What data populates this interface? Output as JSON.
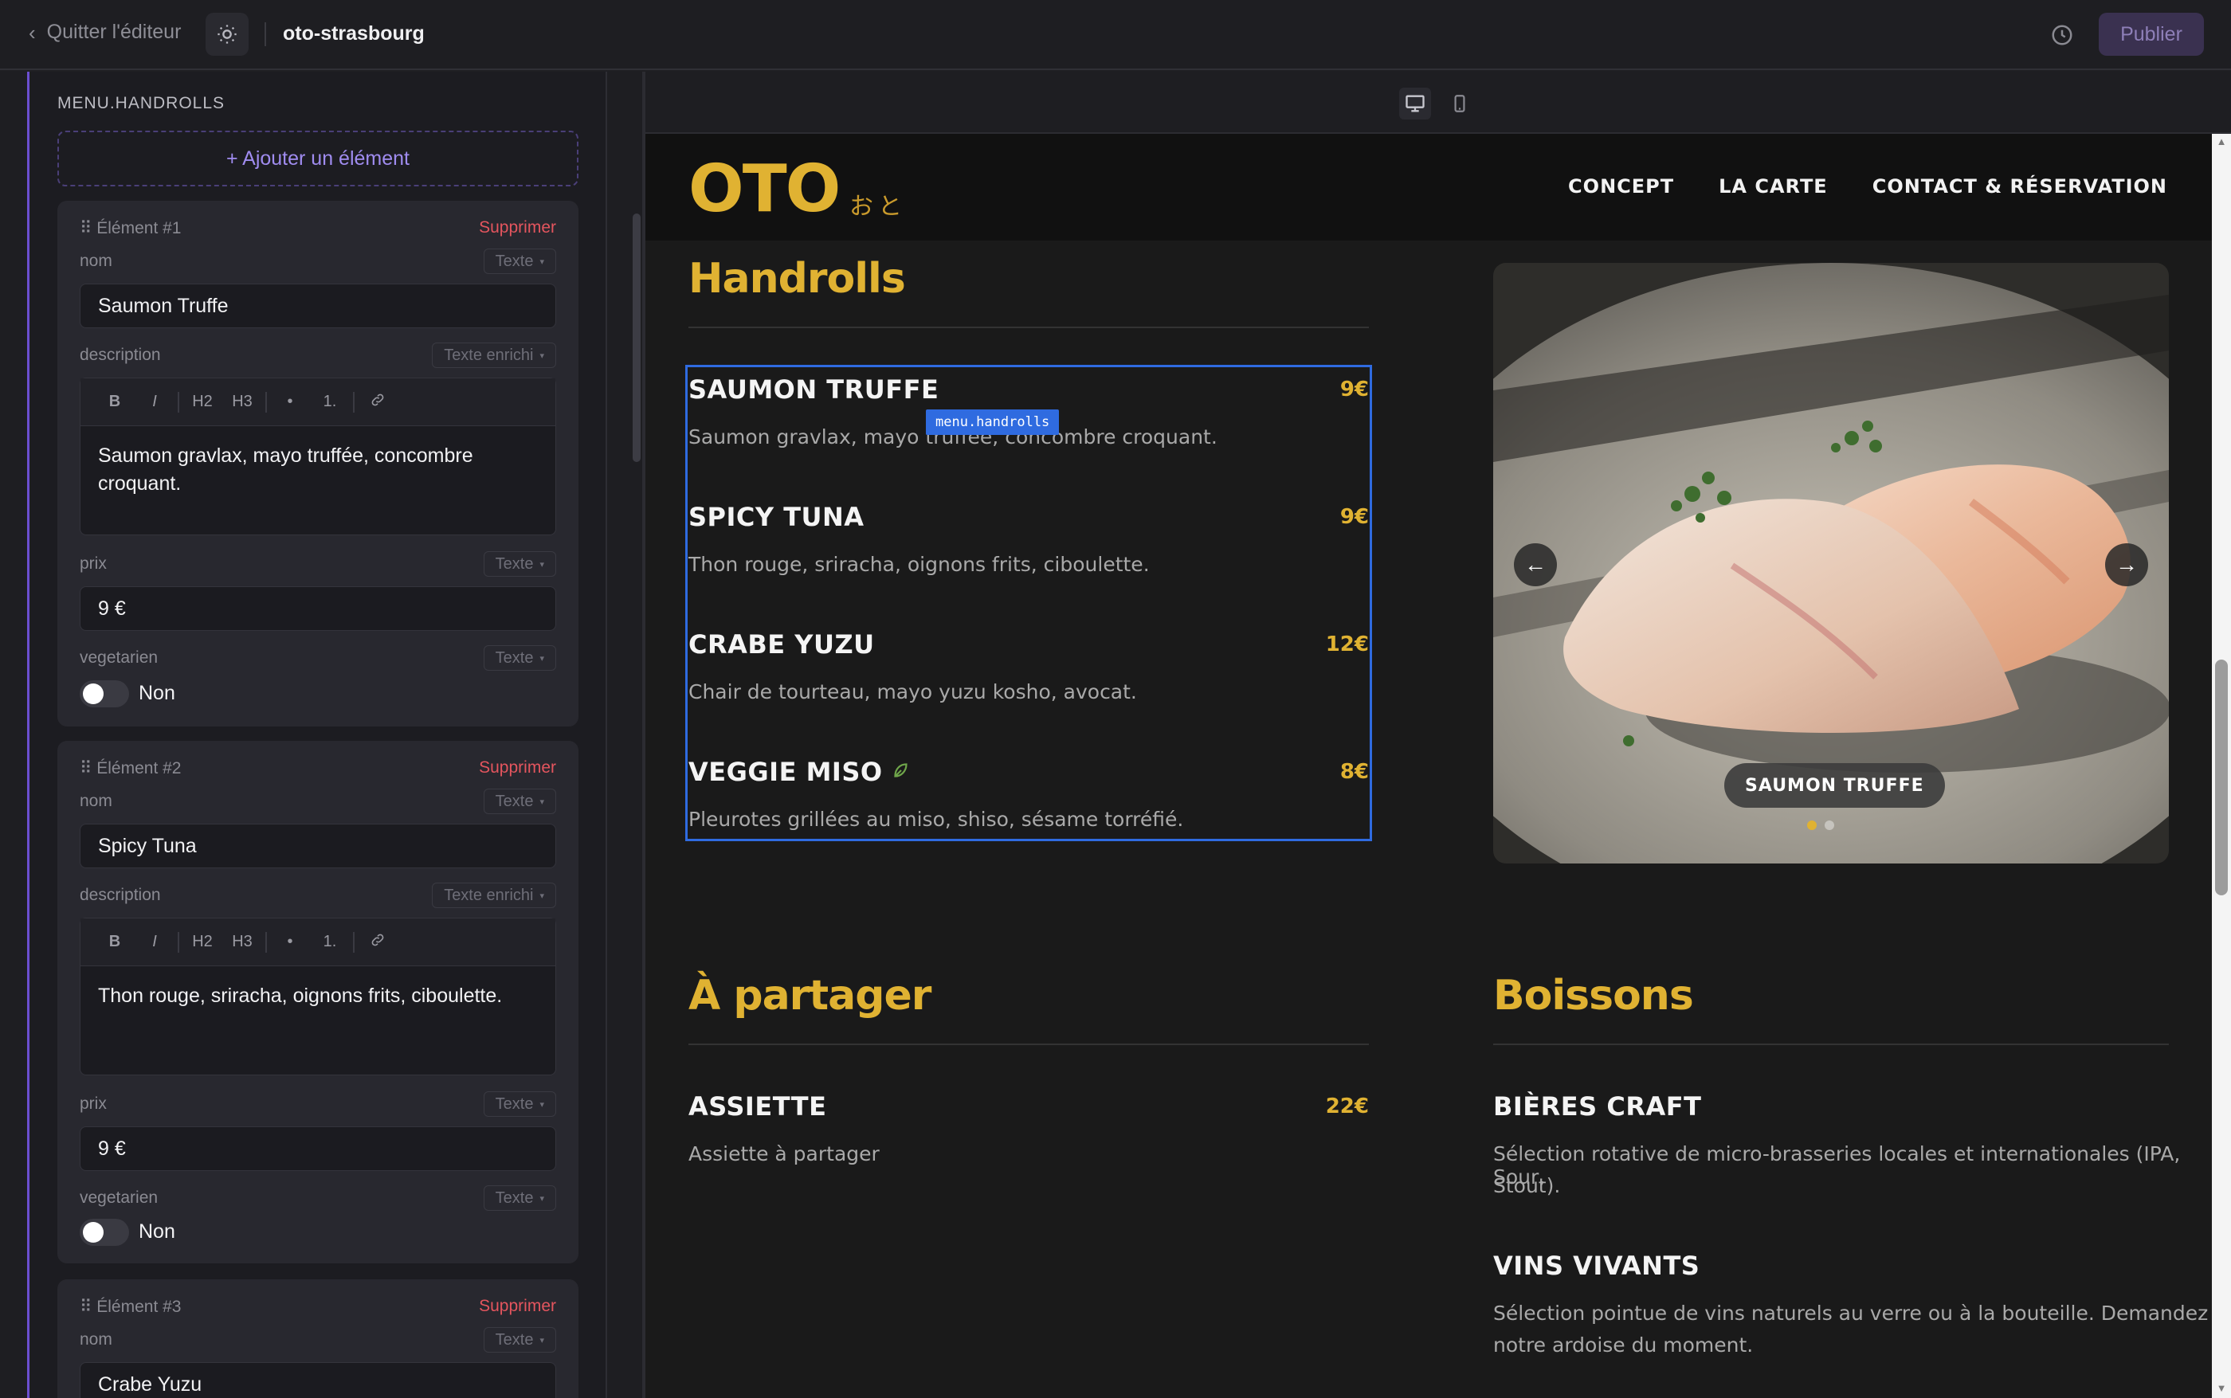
{
  "topbar": {
    "back_label": "Quitter l'éditeur",
    "site_name": "oto-strasbourg",
    "publish_label": "Publier"
  },
  "sidebar": {
    "section_title": "MENU.HANDROLLS",
    "add_label": "+ Ajouter un élément",
    "delete_label": "Supprimer",
    "labels": {
      "nom": "nom",
      "description": "description",
      "prix": "prix",
      "vegetarien": "vegetarien"
    },
    "types": {
      "texte": "Texte",
      "texte_enrichi": "Texte enrichi"
    },
    "toolbar": [
      "B",
      "I",
      "H2",
      "H3",
      "•",
      "1."
    ],
    "items": [
      {
        "header": "Élément #1",
        "nom": "Saumon Truffe",
        "description": "Saumon gravlax, mayo truffée, concombre croquant.",
        "prix": "9 €",
        "vegetarien": "Non"
      },
      {
        "header": "Élément #2",
        "nom": "Spicy Tuna",
        "description": "Thon rouge, sriracha, oignons frits, ciboulette.",
        "prix": "9 €",
        "vegetarien": "Non"
      },
      {
        "header": "Élément #3",
        "nom": "Crabe Yuzu"
      }
    ]
  },
  "preview": {
    "logo": "OTO",
    "logo_jp": "おと",
    "nav": [
      "CONCEPT",
      "LA CARTE",
      "CONTACT & RÉSERVATION"
    ],
    "selection_tag": "menu.handrolls",
    "handrolls": {
      "title": "Handrolls",
      "items": [
        {
          "name": "SAUMON TRUFFE",
          "price": "9€",
          "desc": "Saumon gravlax, mayo truffée, concombre croquant."
        },
        {
          "name": "SPICY TUNA",
          "price": "9€",
          "desc": "Thon rouge, sriracha, oignons frits, ciboulette."
        },
        {
          "name": "CRABE YUZU",
          "price": "12€",
          "desc": "Chair de tourteau, mayo yuzu kosho, avocat."
        },
        {
          "name": "VEGGIE MISO",
          "price": "8€",
          "desc": "Pleurotes grillées au miso, shiso, sésame torréfié.",
          "vegetarian_icon": "leaf-icon"
        }
      ]
    },
    "carousel": {
      "caption": "SAUMON TRUFFE",
      "prev": "←",
      "next": "→"
    },
    "partager": {
      "title": "À partager",
      "items": [
        {
          "name": "ASSIETTE",
          "price": "22€",
          "desc": "Assiette à partager"
        }
      ]
    },
    "boissons": {
      "title": "Boissons",
      "items": [
        {
          "name": "BIÈRES CRAFT",
          "desc_line1": "Sélection rotative de micro-brasseries locales et internationales (IPA, Sour,",
          "desc_line2": "Stout)."
        },
        {
          "name": "VINS VIVANTS",
          "desc_line1": "Sélection pointue de vins naturels au verre ou à la bouteille. Demandez",
          "desc_line2": "notre ardoise du moment."
        }
      ]
    }
  },
  "colors": {
    "accent_gold": "#e0b232",
    "selection_blue": "#2f6be0",
    "delete_red": "#e4555e",
    "editor_purple": "#6c4fd1"
  }
}
